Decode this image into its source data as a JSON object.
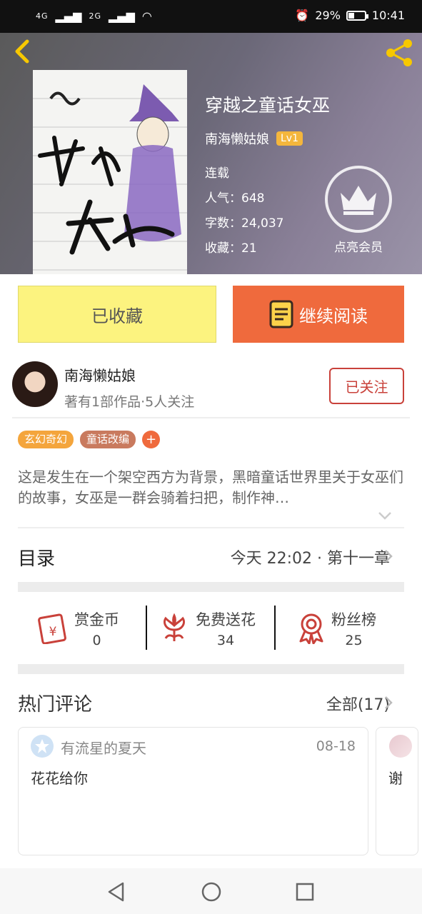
{
  "status_bar": {
    "signal_1": "4G",
    "signal_2": "2G",
    "battery": "29%",
    "time": "10:41"
  },
  "book": {
    "title": "穿越之童话女巫",
    "author": "南海懒姑娘",
    "level": "Lv1",
    "status": "连载",
    "popularity_label": "人气：648",
    "word_count_label": "字数：24,037",
    "favorites_label": "收藏：21",
    "vip_label": "点亮会员"
  },
  "actions": {
    "collected": "已收藏",
    "continue_reading": "继续阅读"
  },
  "author_info": {
    "name": "南海懒姑娘",
    "stats": "著有1部作品·5人关注",
    "follow_label": "已关注"
  },
  "tags": [
    "玄幻奇幻",
    "童话改编"
  ],
  "synopsis": "这是发生在一个架空西方为背景，黑暗童话世界里关于女巫们的故事，女巫是一群会骑着扫把，制作神…",
  "toc": {
    "label": "目录",
    "update": "今天 22:02 · 第十一章"
  },
  "rewards": [
    {
      "label": "赏金币",
      "value": "0",
      "icon": "red-envelope-icon"
    },
    {
      "label": "免费送花",
      "value": "34",
      "icon": "flower-icon"
    },
    {
      "label": "粉丝榜",
      "value": "25",
      "icon": "medal-icon"
    }
  ],
  "comments": {
    "title": "热门评论",
    "all": "全部(17)",
    "items": [
      {
        "user": "有流星的夏天",
        "date": "08-18",
        "text": "花花给你"
      },
      {
        "text": "谢"
      }
    ]
  },
  "colors": {
    "accent_orange": "#ef6a3d",
    "collected_yellow": "#fcf37f",
    "follow_red": "#c9413a",
    "level_badge": "#f4b63c"
  }
}
